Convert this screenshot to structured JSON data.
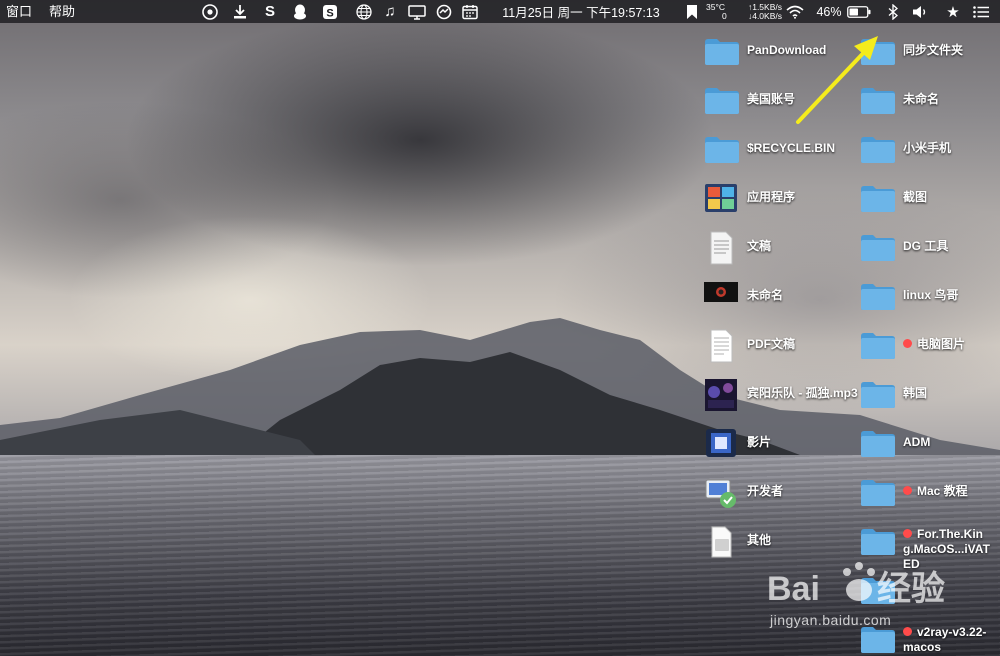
{
  "menubar": {
    "items": [
      "窗口",
      "帮助"
    ],
    "clock": "11月25日 周一 下午19:57:13",
    "temperature": "35°C",
    "net_up": "↑1.5KB/s",
    "net_zero": "0",
    "net_down": "↓4.0KB/s",
    "battery_percent": "46%",
    "icons": [
      "chrome-icon",
      "download-icon",
      "s-app-icon",
      "qq-icon",
      "sogou-icon",
      "globe-icon",
      "music-icon",
      "monitor-icon",
      "sync-icon",
      "calendar-icon",
      "bookmark-icon",
      "wifi-icon",
      "battery-icon",
      "bluetooth-icon",
      "volume-icon",
      "star-icon",
      "list-icon"
    ]
  },
  "desktop": {
    "col1": [
      {
        "label": "PanDownload",
        "icon": "folder-icon"
      },
      {
        "label": "美国账号",
        "icon": "folder-icon"
      },
      {
        "label": "$RECYCLE.BIN",
        "icon": "folder-icon"
      },
      {
        "label": "应用程序",
        "icon": "applications-icon"
      },
      {
        "label": "文稿",
        "icon": "document-icon"
      },
      {
        "label": "未命名",
        "icon": "video-thumb-icon"
      },
      {
        "label": "PDF文稿",
        "icon": "pdf-doc-icon"
      },
      {
        "label": "宾阳乐队 - 孤独.mp3",
        "icon": "mp3-icon"
      },
      {
        "label": "影片",
        "icon": "movie-icon"
      },
      {
        "label": "开发者",
        "icon": "developer-icon"
      },
      {
        "label": "其他",
        "icon": "other-icon"
      }
    ],
    "col2": [
      {
        "label": "同步文件夹",
        "icon": "folder-icon",
        "tag": false
      },
      {
        "label": "未命名",
        "icon": "folder-icon",
        "tag": false
      },
      {
        "label": "小米手机",
        "icon": "folder-icon",
        "tag": false
      },
      {
        "label": "截图",
        "icon": "folder-icon",
        "tag": false
      },
      {
        "label": "DG 工具",
        "icon": "folder-icon",
        "tag": false
      },
      {
        "label": "linux 鸟哥",
        "icon": "folder-icon",
        "tag": false
      },
      {
        "label": "电脑图片",
        "icon": "folder-icon",
        "tag": true
      },
      {
        "label": "韩国",
        "icon": "folder-icon",
        "tag": false
      },
      {
        "label": "ADM",
        "icon": "folder-icon",
        "tag": false
      },
      {
        "label": "Mac 教程",
        "icon": "folder-icon",
        "tag": true
      },
      {
        "label": "For.The.King.MacOS...iVATED",
        "icon": "folder-icon",
        "tag": true
      },
      {
        "label": "",
        "icon": "folder-icon",
        "tag": false
      },
      {
        "label": "v2ray-v3.22-macos",
        "icon": "folder-icon",
        "tag": true
      }
    ]
  },
  "watermark": {
    "text": "jingyan.baidu.com"
  },
  "colors": {
    "folder": "#6cb5e8",
    "folder_dark": "#4b9bd6",
    "tag_red": "#ff4b4b",
    "arrow": "#f5ec1c",
    "menubar": "#1c1c20"
  }
}
